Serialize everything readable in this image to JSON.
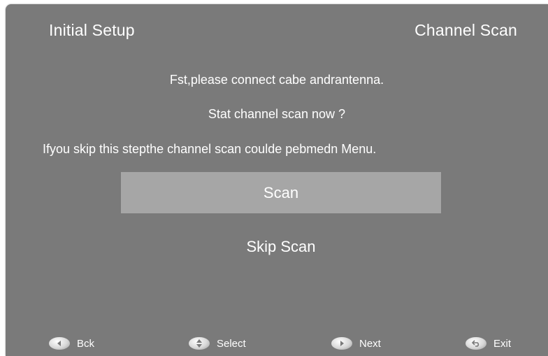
{
  "header": {
    "left_title": "Initial Setup",
    "right_title": "Channel Scan"
  },
  "messages": {
    "line1": "Fst,please connect cabe andrantenna.",
    "line2": "Stat channel scan now ?",
    "line3": "Ifyou skip this stepthe channel scan coulde pebmedn Menu."
  },
  "options": {
    "scan": "Scan",
    "skip": "Skip Scan"
  },
  "footer": {
    "back": {
      "icon": "left-arrow-icon",
      "label": "Bck"
    },
    "select": {
      "icon": "up-down-arrow-icon",
      "label": "Select"
    },
    "next": {
      "icon": "right-arrow-icon",
      "label": "Next"
    },
    "exit": {
      "icon": "return-arrow-icon",
      "label": "Exit"
    }
  },
  "colors": {
    "panel": "#7a7a7a",
    "highlight": "#a6a6a6",
    "text": "#ffffff"
  }
}
